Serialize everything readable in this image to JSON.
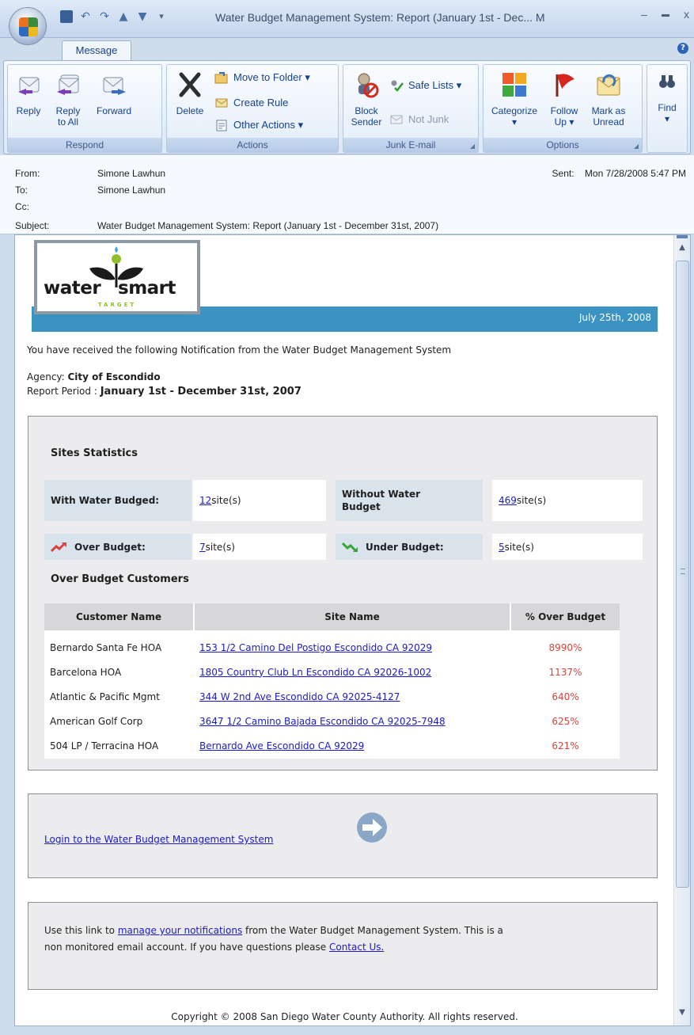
{
  "window": {
    "title": "Water Budget Management System: Report (January 1st - Dec... M",
    "min": "–",
    "max": "▬",
    "close": "x"
  },
  "ribbon": {
    "tab": "Message",
    "help": "?",
    "groups": {
      "respond": "Respond",
      "actions": "Actions",
      "junk": "Junk E-mail",
      "options": "Options"
    },
    "buttons": {
      "reply": "Reply",
      "reply_all_1": "Reply",
      "reply_all_2": "to All",
      "forward": "Forward",
      "delete": "Delete",
      "move_to_folder": "Move to Folder ▾",
      "create_rule": "Create Rule",
      "other_actions": "Other Actions ▾",
      "block_sender_1": "Block",
      "block_sender_2": "Sender",
      "safe_lists": "Safe Lists ▾",
      "not_junk": "Not Junk",
      "categorize_1": "Categorize",
      "categorize_2": "▾",
      "follow_up_1": "Follow",
      "follow_up_2": "Up ▾",
      "mark_unread_1": "Mark as",
      "mark_unread_2": "Unread",
      "find_1": "Find",
      "find_2": "▾"
    }
  },
  "header": {
    "from_label": "From:",
    "from": "Simone Lawhun",
    "to_label": "To:",
    "to": "Simone Lawhun",
    "cc_label": "Cc:",
    "cc": "",
    "subject_label": "Subject:",
    "subject": "Water Budget Management System: Report (January 1st - December 31st, 2007)",
    "sent_label": "Sent:",
    "sent": "Mon 7/28/2008 5:47 PM"
  },
  "email": {
    "logo_word_left": "water",
    "logo_word_right": "smart",
    "logo_sub": "TARGET",
    "date": "July 25th, 2008",
    "intro": "You have received the following Notification from the Water Budget Management System",
    "agency_label": "Agency: ",
    "agency": "City of Escondido",
    "period_label": "Report Period : ",
    "period": "January 1st - December 31st, 2007",
    "stats_title": "Sites Statistics",
    "with_budget_label": "With Water Budged:",
    "with_budget_count": "12",
    "without_budget_label_1": "Without Water",
    "without_budget_label_2": "Budget",
    "without_budget_count": "469",
    "sites_suffix": " site(s)",
    "over_label": "Over Budget:",
    "over_count": "7",
    "under_label": "Under Budget:",
    "under_count": "5",
    "customers_title": "Over Budget Customers",
    "columns": [
      "Customer Name",
      "Site Name",
      "% Over Budget"
    ],
    "rows": [
      {
        "customer": "Bernardo Santa Fe HOA",
        "site": "153 1/2 Camino Del Postigo Escondido CA 92029",
        "pct": "8990%"
      },
      {
        "customer": "Barcelona HOA",
        "site": "1805 Country Club Ln Escondido CA 92026-1002",
        "pct": "1137%"
      },
      {
        "customer": "Atlantic & Pacific Mgmt",
        "site": "344 W 2nd Ave Escondido CA 92025-4127",
        "pct": "640%"
      },
      {
        "customer": "American Golf Corp",
        "site": "3647 1/2 Camino Bajada Escondido CA 92025-7948",
        "pct": "625%"
      },
      {
        "customer": "504 LP / Terracina HOA",
        "site": "Bernardo Ave Escondido CA 92029",
        "pct": "621%"
      }
    ],
    "login_link": "Login to the Water Budget Management System",
    "notice_1a": "Use this link to ",
    "notice_link": "manage your notifications",
    "notice_1b": " from the Water Budget Management System. This is a",
    "notice_2a": "non monitored email account. If you have questions please ",
    "contact_link": "Contact Us.",
    "copyright": "Copyright © 2008 San Diego Water County Authority. All rights reserved."
  }
}
